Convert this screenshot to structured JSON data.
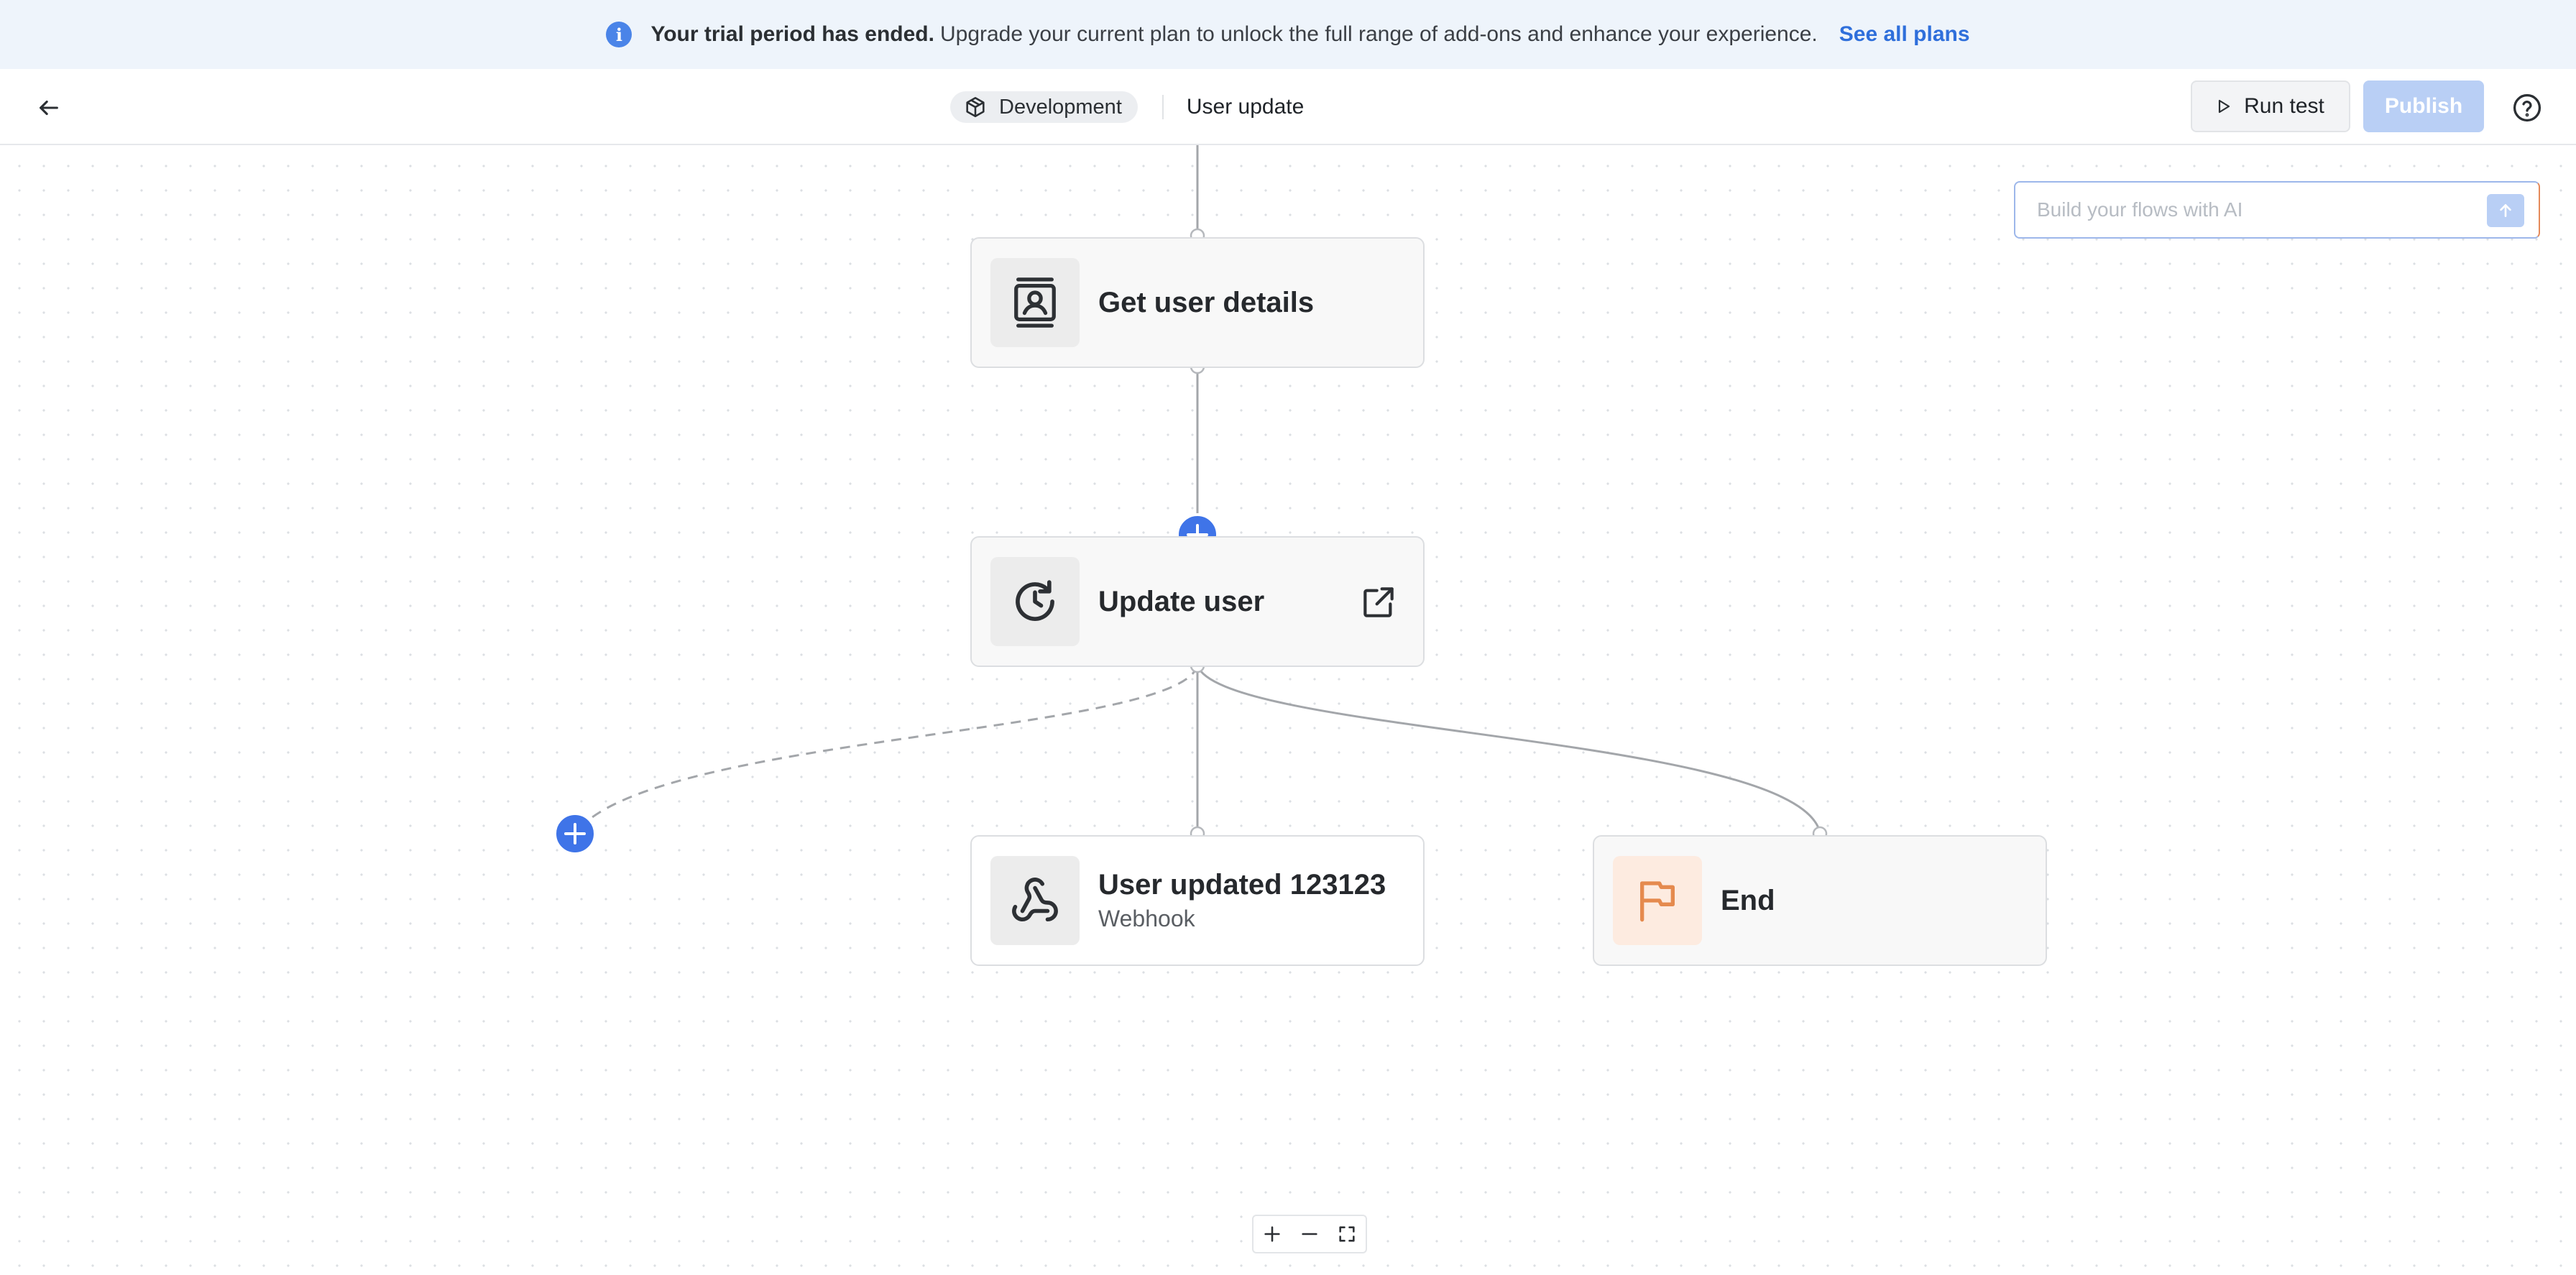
{
  "banner": {
    "icon": "info-icon",
    "title": "Your trial period has ended.",
    "message": "Upgrade your current plan to unlock the full range of add-ons and enhance your experience.",
    "link_label": "See all plans"
  },
  "header": {
    "environment": "Development",
    "flow_name": "User update",
    "run_test_label": "Run test",
    "publish_label": "Publish"
  },
  "ai": {
    "placeholder": "Build your flows with AI"
  },
  "nodes": {
    "get_user_details": {
      "title": "Get user details",
      "icon": "contact-book-icon"
    },
    "update_user": {
      "title": "Update user",
      "icon": "history-icon"
    },
    "user_updated": {
      "title": "User updated 123123",
      "subtitle": "Webhook",
      "icon": "webhook-icon"
    },
    "end": {
      "title": "End",
      "icon": "flag-icon"
    }
  },
  "colors": {
    "accent": "#3f74e8",
    "publish_disabled": "#b9cff5",
    "banner_bg": "#eef4fb",
    "end_icon": "#e58a4e"
  }
}
